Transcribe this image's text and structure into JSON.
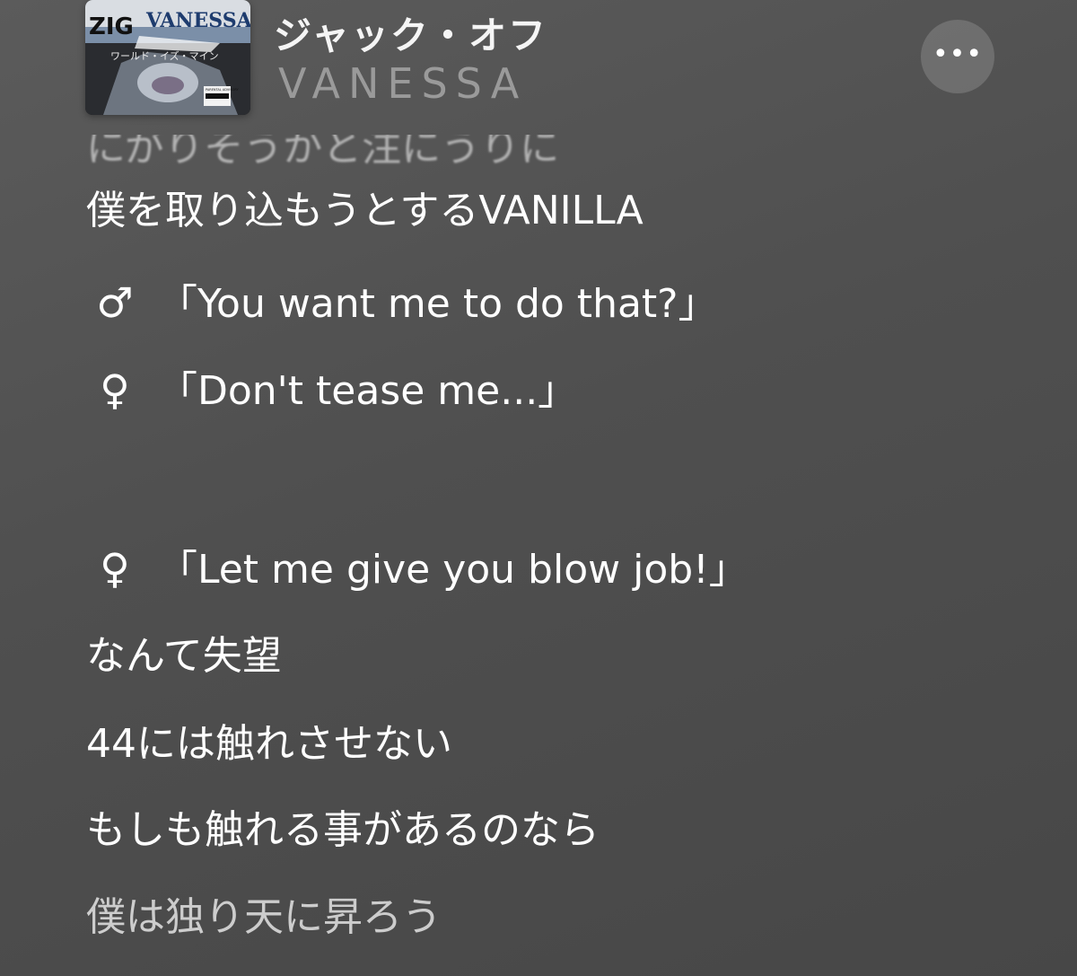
{
  "now_playing": {
    "title": "ジャック・オフ",
    "artist": "VANESSA",
    "more_label": "•••",
    "artwork": {
      "band_text": "VANESSA",
      "logo_text": "ZIG",
      "subtitle_text": "ワールド・イズ・マイン",
      "advisory_text": "PARENTAL ADVISORY"
    }
  },
  "lyrics": {
    "faded_previous": "にがりそうかと注にうりに",
    "lines": [
      {
        "symbol": "",
        "text": "僕を取り込もうとするVANILLA"
      },
      {
        "symbol": "♂",
        "text": "「You want me to do that?」"
      },
      {
        "symbol": "♀",
        "text": "「Don't tease me...」"
      },
      {
        "symbol": "♀",
        "text": "「Let me give you blow job!」"
      },
      {
        "symbol": "",
        "text": "なんて失望"
      },
      {
        "symbol": "",
        "text": "44には触れさせない"
      },
      {
        "symbol": "",
        "text": "もしも触れる事があるのなら"
      },
      {
        "symbol": "",
        "text": "僕は独り天に昇ろう"
      }
    ]
  }
}
